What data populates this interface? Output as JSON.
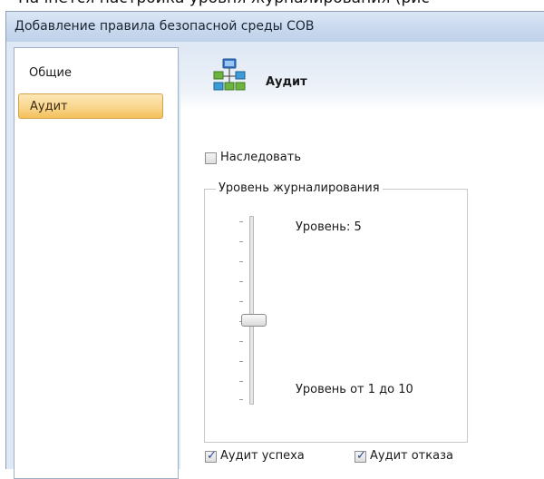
{
  "caption": "Начнётся настройка уровня журналирования (рис",
  "window": {
    "title": "Добавление правила безопасной среды СОВ"
  },
  "sidebar": {
    "items": [
      {
        "label": "Общие",
        "selected": false
      },
      {
        "label": "Аудит",
        "selected": true
      }
    ]
  },
  "page": {
    "title": "Аудит",
    "icon": "network-icon"
  },
  "inherit": {
    "label": "Наследовать",
    "checked": false
  },
  "logging": {
    "group_title": "Уровень журналирования",
    "level_text": "Уровень: 5",
    "level": 5,
    "min": 1,
    "max": 10,
    "range_text": "Уровень от 1 до 10"
  },
  "audit_options": [
    {
      "label": "Аудит успеха",
      "checked": true
    },
    {
      "label": "Аудит отказа",
      "checked": true
    }
  ],
  "colors": {
    "selection": "#f9d68e",
    "accent_blue": "#3a78c9",
    "accent_green": "#6db33f"
  }
}
